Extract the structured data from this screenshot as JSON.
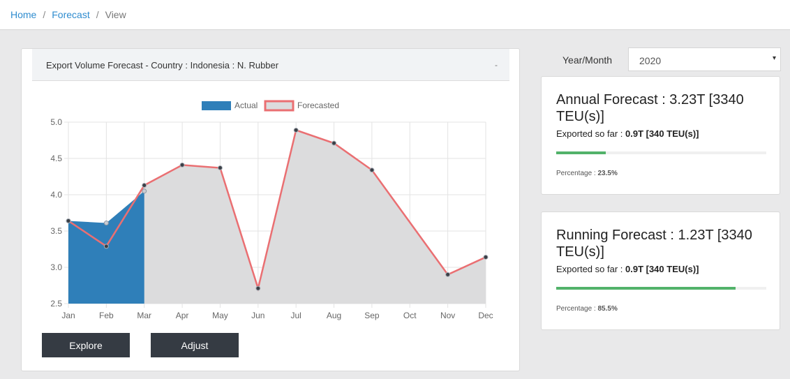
{
  "breadcrumb": {
    "home": "Home",
    "forecast": "Forecast",
    "current": "View",
    "separator": "/"
  },
  "panel": {
    "title": "Export Volume Forecast - Country : Indonesia : N. Rubber",
    "collapse_label": "-"
  },
  "buttons": {
    "explore": "Explore",
    "adjust": "Adjust"
  },
  "filter": {
    "label": "Year/Month",
    "selected": "2020",
    "caret": "▾"
  },
  "cards": [
    {
      "title": "Annual Forecast : 3.23T [3340 TEU(s)]",
      "exported_label": "Exported so far : ",
      "exported_value": "0.9T [340 TEU(s)]",
      "percentage_label": "Percentage : ",
      "percentage_value": "23.5%",
      "progress": 0.235
    },
    {
      "title": "Running Forecast : 1.23T [3340 TEU(s)]",
      "exported_label": "Exported so far : ",
      "exported_value": "0.9T [340 TEU(s)]",
      "percentage_label": "Percentage : ",
      "percentage_value": "85.5%",
      "progress": 0.855
    }
  ],
  "colors": {
    "actual": "#2f7fb9",
    "forecast_line": "#ea6f72",
    "forecast_fill": "#dcdcdd",
    "progress": "#52b26a",
    "link": "#2f8ccf",
    "button": "#353b43"
  },
  "chart_data": {
    "type": "area",
    "categories": [
      "Jan",
      "Feb",
      "Mar",
      "Apr",
      "May",
      "Jun",
      "Jul",
      "Aug",
      "Sep",
      "Oct",
      "Nov",
      "Dec"
    ],
    "series": [
      {
        "name": "Actual",
        "values": [
          3.64,
          3.61,
          4.05,
          null,
          null,
          null,
          null,
          null,
          null,
          null,
          null,
          null
        ]
      },
      {
        "name": "Forecasted",
        "values": [
          3.64,
          3.29,
          4.13,
          4.41,
          4.37,
          2.71,
          4.89,
          4.71,
          4.34,
          null,
          2.9,
          3.14
        ]
      }
    ],
    "ylim": [
      2.5,
      5.0
    ],
    "yticks": [
      "2.5",
      "3.0",
      "3.5",
      "4.0",
      "4.5",
      "5.0"
    ],
    "grid": true,
    "legend": "top"
  }
}
